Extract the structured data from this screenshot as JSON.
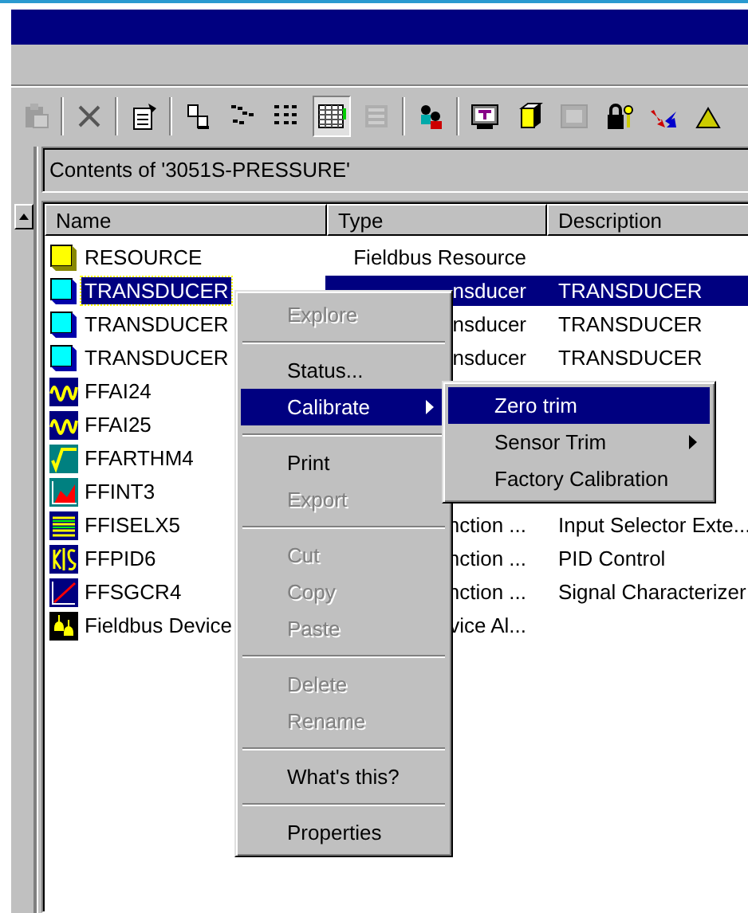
{
  "toolbar": [
    {
      "kind": "paste",
      "disabled": true
    },
    {
      "kind": "separator"
    },
    {
      "kind": "delete",
      "disabled": true
    },
    {
      "kind": "separator"
    },
    {
      "kind": "properties",
      "disabled": false
    },
    {
      "kind": "separator"
    },
    {
      "kind": "large-icons",
      "disabled": false,
      "pressed": false
    },
    {
      "kind": "small-icons",
      "disabled": false,
      "pressed": false
    },
    {
      "kind": "list",
      "disabled": false,
      "pressed": false
    },
    {
      "kind": "details",
      "disabled": false,
      "pressed": true
    },
    {
      "kind": "grid",
      "disabled": true
    },
    {
      "kind": "separator"
    },
    {
      "kind": "users",
      "disabled": false
    },
    {
      "kind": "separator"
    },
    {
      "kind": "monitor",
      "disabled": false
    },
    {
      "kind": "box",
      "disabled": false
    },
    {
      "kind": "screen",
      "disabled": true
    },
    {
      "kind": "lock",
      "disabled": false
    },
    {
      "kind": "arrows",
      "disabled": false
    },
    {
      "kind": "triangle"
    }
  ],
  "address": "Contents of '3051S-PRESSURE'",
  "list": {
    "columns": [
      "Name",
      "Type",
      "Description"
    ],
    "rows": [
      {
        "kind": "resource",
        "name": "RESOURCE",
        "type": "Fieldbus Resource",
        "selected": false
      },
      {
        "kind": "transducer",
        "name": "TRANSDUCER",
        "type": "nsducer",
        "description": "TRANSDUCER",
        "selected": true
      },
      {
        "kind": "transducer",
        "name": "TRANSDUCER",
        "type": "nsducer",
        "description": "TRANSDUCER",
        "selected": false
      },
      {
        "kind": "transducer",
        "name": "TRANSDUCER",
        "type": "nsducer",
        "description": "TRANSDUCER",
        "selected": false
      },
      {
        "kind": "ai",
        "name": "FFAI24",
        "selected": false
      },
      {
        "kind": "ai",
        "name": "FFAI25",
        "selected": false
      },
      {
        "kind": "arithmetic",
        "name": "FFARTHM4",
        "selected": false
      },
      {
        "kind": "integrator",
        "name": "FFINT3",
        "selected": false
      },
      {
        "kind": "selector",
        "name": "FFISELX5",
        "type": "nction ...",
        "description": "Input Selector Exte...",
        "selected": false
      },
      {
        "kind": "pid",
        "name": "FFPID6",
        "type": "nction ...",
        "description": "PID Control",
        "selected": false
      },
      {
        "kind": "characterizer",
        "name": "FFSGCR4",
        "type": "nction ...",
        "description": "Signal Characterizer",
        "selected": false
      },
      {
        "kind": "alert",
        "name": "Fieldbus Device",
        "type": "vice Al...",
        "selected": false
      }
    ]
  },
  "context_menu": [
    {
      "kind": "item",
      "label": "Explore",
      "disabled": true,
      "selected": false
    },
    {
      "kind": "separator"
    },
    {
      "kind": "item",
      "label": "Status...",
      "disabled": false,
      "selected": false
    },
    {
      "kind": "item",
      "label": "Calibrate",
      "disabled": false,
      "selected": true,
      "submenu": true
    },
    {
      "kind": "separator"
    },
    {
      "kind": "item",
      "label": "Print",
      "disabled": false,
      "selected": false
    },
    {
      "kind": "item",
      "label": "Export",
      "disabled": true,
      "selected": false
    },
    {
      "kind": "separator"
    },
    {
      "kind": "item",
      "label": "Cut",
      "disabled": true,
      "selected": false
    },
    {
      "kind": "item",
      "label": "Copy",
      "disabled": true,
      "selected": false
    },
    {
      "kind": "item",
      "label": "Paste",
      "disabled": true,
      "selected": false
    },
    {
      "kind": "separator"
    },
    {
      "kind": "item",
      "label": "Delete",
      "disabled": true,
      "selected": false
    },
    {
      "kind": "item",
      "label": "Rename",
      "disabled": true,
      "selected": false
    },
    {
      "kind": "separator"
    },
    {
      "kind": "item",
      "label": "What's this?",
      "disabled": false,
      "selected": false
    },
    {
      "kind": "separator"
    },
    {
      "kind": "item",
      "label": "Properties",
      "disabled": false,
      "selected": false
    }
  ],
  "submenu": [
    {
      "kind": "item",
      "label": "Zero trim",
      "disabled": false,
      "selected": true
    },
    {
      "kind": "item",
      "label": "Sensor Trim",
      "disabled": false,
      "selected": false,
      "submenu": true
    },
    {
      "kind": "item",
      "label": "Factory Calibration",
      "disabled": false,
      "selected": false
    }
  ]
}
